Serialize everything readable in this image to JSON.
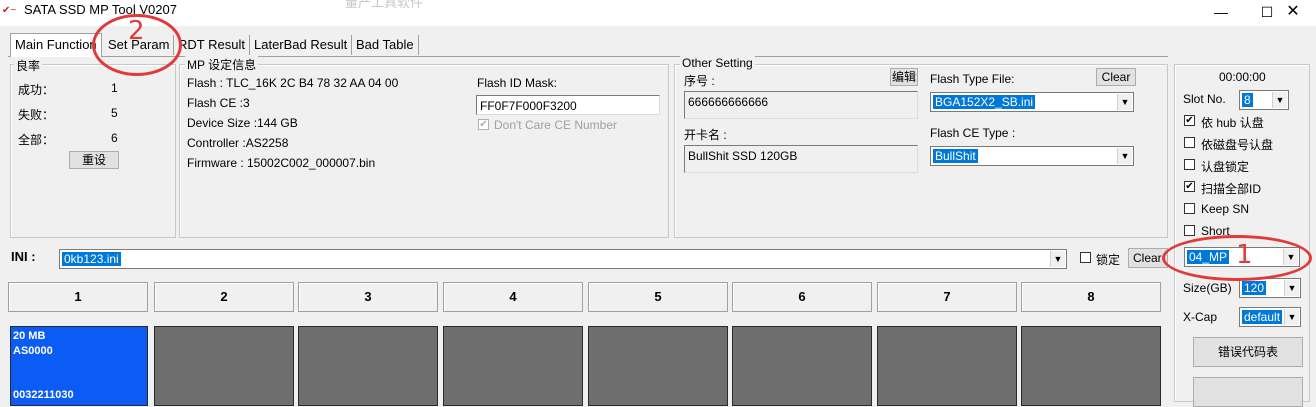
{
  "window": {
    "title": "SATA SSD MP Tool V0207",
    "faded_title": "量产工具软件"
  },
  "tabs": [
    {
      "label": "Main Function"
    },
    {
      "label": "Set Param"
    },
    {
      "label": "RDT Result"
    },
    {
      "label": "LaterBad Result"
    },
    {
      "label": "Bad Table"
    }
  ],
  "yield": {
    "title": "良率",
    "success_label": "成功：",
    "success_value": "1",
    "fail_label": "失败：",
    "fail_value": "5",
    "total_label": "全部：",
    "total_value": "6",
    "reset_label": "重设"
  },
  "mp_info": {
    "title": "MP 设定信息",
    "flash": "Flash : TLC_16K 2C B4 78 32 AA 04 00",
    "flash_ce": "Flash CE :3",
    "device_size": "Device Size :144 GB",
    "controller": "Controller :AS2258",
    "firmware": "Firmware : 15002C002_000007.bin",
    "flash_id_mask_label": "Flash ID Mask:",
    "flash_id_mask_value": "FF0F7F000F3200",
    "dont_care_ce": "Don't Care CE Number"
  },
  "other": {
    "title": "Other Setting",
    "serial_label": "序号 :",
    "edit_label": "编辑",
    "serial_value": "666666666666",
    "card_name_label": "开卡名 :",
    "card_name_value": "BullShit SSD 120GB",
    "flash_type_label": "Flash Type File:",
    "clear_label": "Clear",
    "flash_type_value": "BGA152X2_SB.ini",
    "flash_ce_type_label": "Flash CE Type :",
    "flash_ce_type_value": "BullShit"
  },
  "ini": {
    "label": "INI :",
    "value": "0kb123.ini",
    "lock_label": "锁定",
    "clear_label": "Clear"
  },
  "right_panel": {
    "timer": "00:00:00",
    "slot_no_label": "Slot No.",
    "slot_no_value": "8",
    "checks": [
      {
        "label": "依 hub 认盘",
        "checked": true
      },
      {
        "label": "依磁盘号认盘",
        "checked": false
      },
      {
        "label": "认盘锁定",
        "checked": false
      },
      {
        "label": "扫描全部ID",
        "checked": true
      },
      {
        "label": "Keep SN",
        "checked": false
      },
      {
        "label": "Short",
        "checked": false
      }
    ],
    "mode_value": "04_MP",
    "size_label": "Size(GB)",
    "size_value": "120",
    "xcap_label": "X-Cap",
    "xcap_value": "default",
    "error_code_label": "错误代码表"
  },
  "slots": {
    "headers": [
      "1",
      "2",
      "3",
      "4",
      "5",
      "6",
      "7",
      "8"
    ],
    "slot1_line1": "20 MB",
    "slot1_line2": "AS0000",
    "slot1_line3": "0032211030"
  },
  "annotations": {
    "num1": "1",
    "num2": "2"
  }
}
